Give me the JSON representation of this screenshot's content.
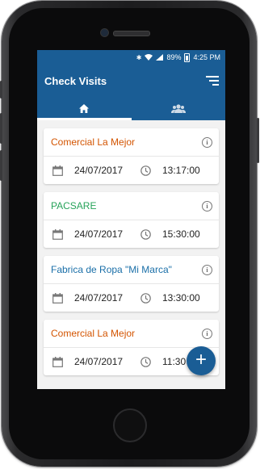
{
  "status_bar": {
    "battery_percent": "89%",
    "time": "4:25 PM",
    "icons": [
      "bluetooth-icon",
      "wifi-icon",
      "signal-icon",
      "battery-icon"
    ]
  },
  "app_bar": {
    "title": "Check Visits",
    "menu_icon": "sort-menu-icon"
  },
  "tabs": [
    {
      "icon": "home-icon",
      "active": true
    },
    {
      "icon": "group-icon",
      "active": false
    }
  ],
  "visits": [
    {
      "name": "Comercial La Mejor",
      "name_color": "#d35400",
      "date": "24/07/2017",
      "time": "13:17:00"
    },
    {
      "name": "PACSARE",
      "name_color": "#27a35a",
      "date": "24/07/2017",
      "time": "15:30:00"
    },
    {
      "name": "Fabrica de Ropa \"Mi Marca\"",
      "name_color": "#1a6fa8",
      "date": "24/07/2017",
      "time": "13:30:00"
    },
    {
      "name": "Comercial La Mejor",
      "name_color": "#d35400",
      "date": "24/07/2017",
      "time": "11:30"
    }
  ],
  "fab": {
    "label": "+"
  },
  "colors": {
    "primary": "#1a5d95",
    "background": "#f2f2f2"
  }
}
